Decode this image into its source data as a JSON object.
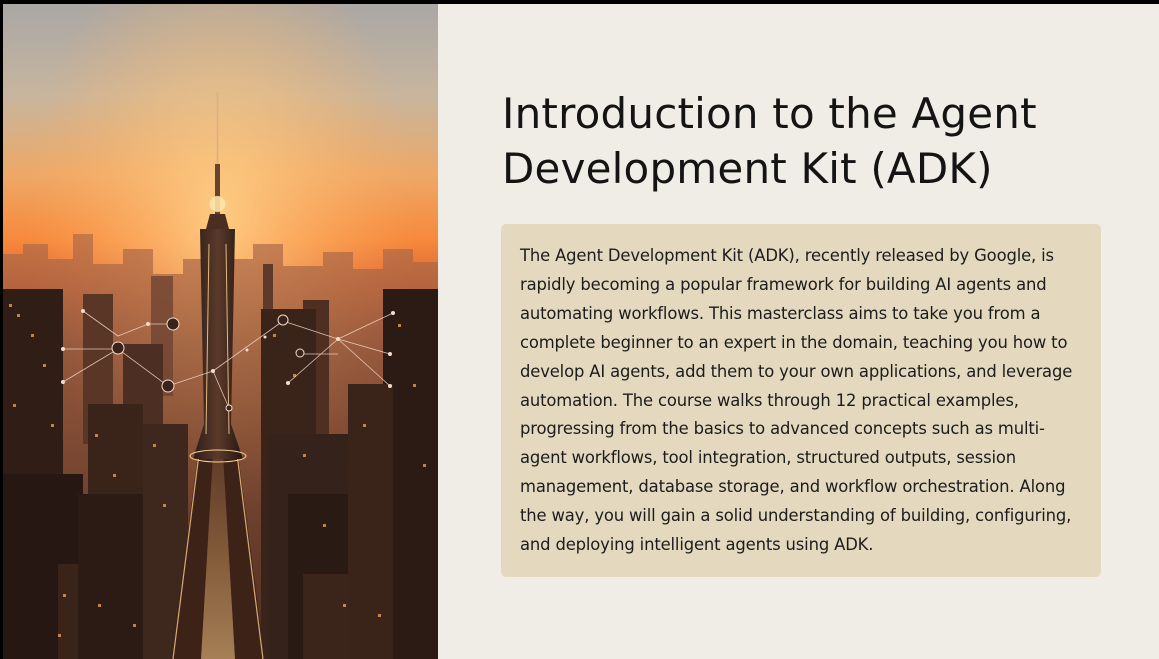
{
  "slide": {
    "title": "Introduction to the Agent Development Kit (ADK)",
    "body": "The Agent Development Kit (ADK), recently released by Google, is rapidly becoming a popular framework for building AI agents and automating workflows. This masterclass aims to take you from a complete beginner to an expert in the domain, teaching you how to develop AI agents, add them to your own applications, and leverage automation. The course walks through 12 practical examples, progressing from the basics to advanced concepts such as multi-agent workflows, tool integration, structured outputs, session management, database storage, and workflow orchestration. Along the way, you will gain a solid understanding of building, configuring, and deploying intelligent agents using ADK.",
    "hero_image": "city-skyline-sunset-network-illustration"
  },
  "colors": {
    "background": "#f0ede6",
    "card": "#e4d9bf",
    "title_text": "#141414",
    "body_text": "#1c1c1c",
    "sky_top": "#a9a7a2",
    "sky_glow": "#f08a3a",
    "city_dark": "#3a241a"
  }
}
